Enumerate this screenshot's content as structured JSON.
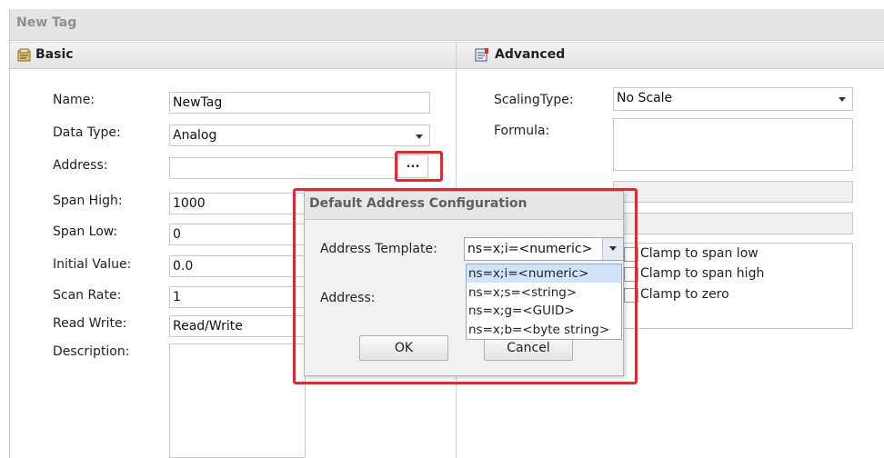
{
  "window": {
    "title": "New Tag"
  },
  "basic": {
    "header": "Basic",
    "fields": [
      {
        "label": "Name:",
        "value": "NewTag"
      },
      {
        "label": "Data Type:",
        "value": "Analog"
      },
      {
        "label": "Address:",
        "value": "",
        "button": "..."
      },
      {
        "label": "Span High:",
        "value": "1000"
      },
      {
        "label": "Span Low:",
        "value": "0"
      },
      {
        "label": "Initial Value:",
        "value": "0.0"
      },
      {
        "label": "Scan Rate:",
        "value": "1"
      },
      {
        "label": "Read Write:",
        "value": "Read/Write"
      },
      {
        "label": "Description:",
        "value": ""
      }
    ]
  },
  "advanced": {
    "header": "Advanced",
    "scaling_label": "ScalingType:",
    "scaling_value": "No Scale",
    "formula_label": "Formula:",
    "checkboxes": [
      "Clamp to span low",
      "Clamp to span high",
      "Clamp to zero"
    ]
  },
  "dialog": {
    "title": "Default Address Configuration",
    "template_label": "Address Template:",
    "template_value": "ns=x;i=<numeric>",
    "address_label": "Address:",
    "options": [
      "ns=x;i=<numeric>",
      "ns=x;s=<string>",
      "ns=x;g=<GUID>",
      "ns=x;b=<byte string>"
    ],
    "ok_label": "OK",
    "cancel_label": "Cancel"
  },
  "colors": {
    "highlight": "#e8262c",
    "selected_option": "#cfe3fa"
  }
}
